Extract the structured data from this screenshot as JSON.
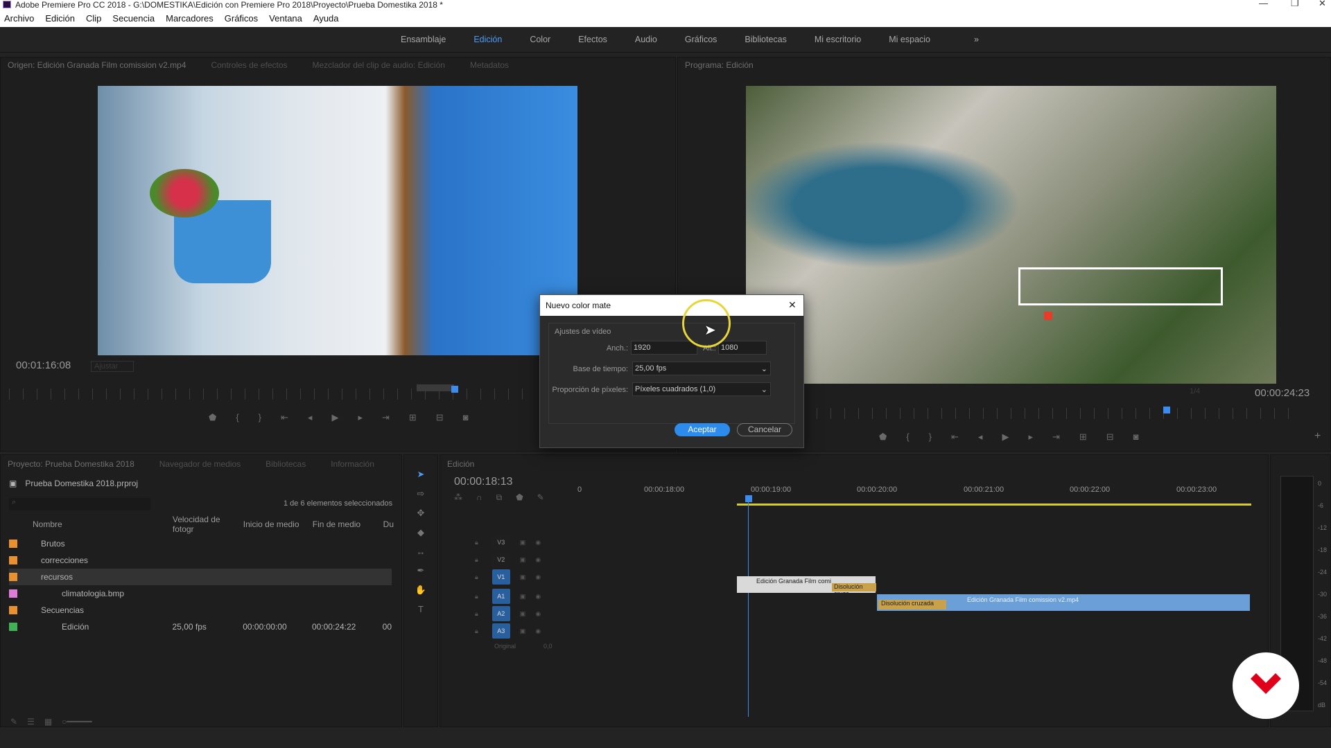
{
  "app": {
    "title": "Adobe Premiere Pro CC 2018 - G:\\DOMESTIKA\\Edición con Premiere Pro 2018\\Proyecto\\Prueba Domestika 2018 *"
  },
  "menu": [
    "Archivo",
    "Edición",
    "Clip",
    "Secuencia",
    "Marcadores",
    "Gráficos",
    "Ventana",
    "Ayuda"
  ],
  "workspaces": [
    "Ensamblaje",
    "Edición",
    "Color",
    "Efectos",
    "Audio",
    "Gráficos",
    "Bibliotecas",
    "Mi escritorio",
    "Mi espacio"
  ],
  "source": {
    "tabs": [
      "Origen: Edición Granada Film comission v2.mp4",
      "Controles de efectos",
      "Mezclador del clip de audio: Edición",
      "Metadatos"
    ],
    "timecode": "00:01:16:08",
    "fit": "Ajustar"
  },
  "program": {
    "tab": "Programa: Edición",
    "timecode": "00:00:24:23",
    "zoom": "1/4"
  },
  "dialog": {
    "title": "Nuevo color mate",
    "section": "Ajustes de vídeo",
    "width_label": "Anch.:",
    "width": "1920",
    "height_label": "Alt.:",
    "height": "1080",
    "timebase_label": "Base de tiempo:",
    "timebase": "25,00  fps",
    "par_label": "Proporción de píxeles:",
    "par": "Píxeles cuadrados (1,0)",
    "ok": "Aceptar",
    "cancel": "Cancelar"
  },
  "project": {
    "tabs": [
      "Proyecto: Prueba Domestika 2018",
      "Navegador de medios",
      "Bibliotecas",
      "Información"
    ],
    "file": "Prueba Domestika 2018.prproj",
    "count": "1 de 6 elementos seleccionados",
    "cols": [
      "Nombre",
      "Velocidad de fotogr",
      "Inicio de medio",
      "Fin de medio",
      "Du"
    ],
    "items": [
      {
        "name": "Brutos",
        "color": "#e8912e",
        "fps": "",
        "in": "",
        "out": "",
        "d": ""
      },
      {
        "name": "correcciones",
        "color": "#e8912e",
        "fps": "",
        "in": "",
        "out": "",
        "d": ""
      },
      {
        "name": "recursos",
        "color": "#e8912e",
        "fps": "",
        "in": "",
        "out": "",
        "d": ""
      },
      {
        "name": "climatologia.bmp",
        "color": "#e07bd9",
        "fps": "",
        "in": "",
        "out": "",
        "d": ""
      },
      {
        "name": "Secuencias",
        "color": "#e8912e",
        "fps": "",
        "in": "",
        "out": "",
        "d": ""
      },
      {
        "name": "Edición",
        "color": "#3fb356",
        "fps": "25,00 fps",
        "in": "00:00:00:00",
        "out": "00:00:24:22",
        "d": "00"
      }
    ]
  },
  "timeline": {
    "tab": "Edición",
    "timecode": "00:00:18:13",
    "ruler": [
      "00:00:18:00",
      "00:00:19:00",
      "00:00:20:00",
      "00:00:21:00",
      "00:00:22:00",
      "00:00:23:00"
    ],
    "tracks": [
      "V3",
      "V2",
      "V1",
      "A1",
      "A2",
      "A3"
    ],
    "original": "Original",
    "orig_val": "0,0",
    "clips": {
      "v2": "Edición Granada Film comi",
      "trans1": "Disolución cruza",
      "trans2": "Disolución cruzada",
      "v1": "Edición Granada Film comission v2.mp4"
    }
  },
  "meter": [
    "0",
    "-6",
    "-12",
    "-18",
    "-24",
    "-30",
    "-36",
    "-42",
    "-48",
    "-54",
    "dB"
  ]
}
